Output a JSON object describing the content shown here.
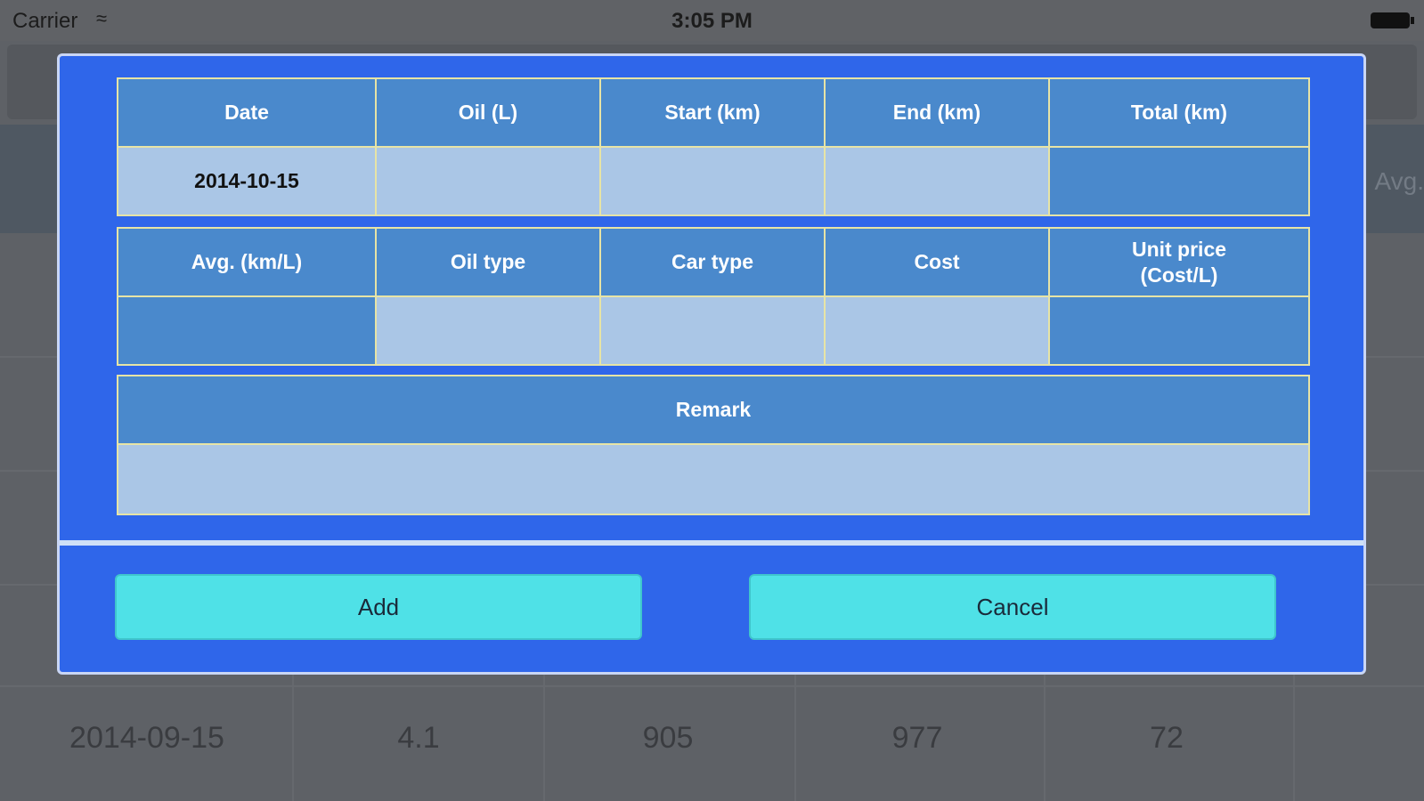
{
  "status_bar": {
    "carrier": "Carrier",
    "time": "3:05 PM"
  },
  "background": {
    "header_partial": "Avg.",
    "last_row": [
      "2014-09-15",
      "4.1",
      "905",
      "977",
      "72"
    ]
  },
  "dialog": {
    "row1_headers": [
      "Date",
      "Oil (L)",
      "Start (km)",
      "End (km)",
      "Total (km)"
    ],
    "row1_values": [
      "2014-10-15",
      "",
      "",
      "",
      ""
    ],
    "row2_headers": [
      "Avg. (km/L)",
      "Oil type",
      "Car type",
      "Cost",
      "Unit price\n(Cost/L)"
    ],
    "row2_values": [
      "",
      "",
      "",
      "",
      ""
    ],
    "remark_header": "Remark",
    "remark_value": "",
    "add_label": "Add",
    "cancel_label": "Cancel"
  },
  "colors": {
    "dialog_bg": "#2f66ea",
    "header_cell": "#4a89cc",
    "input_cell": "#aac6e6",
    "button": "#4fe1e7"
  }
}
